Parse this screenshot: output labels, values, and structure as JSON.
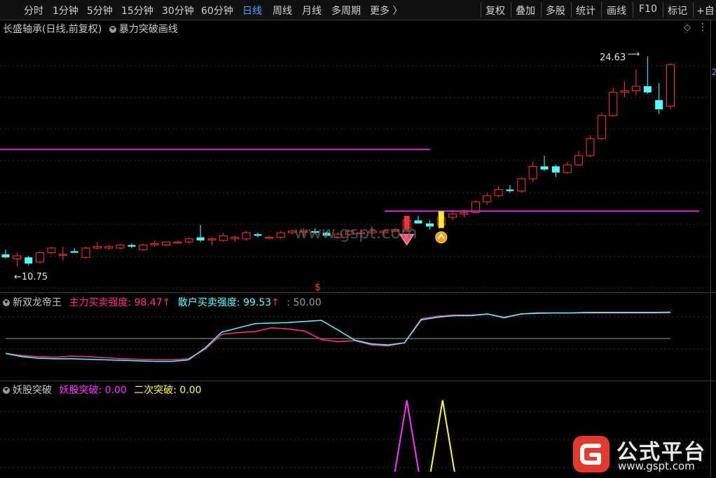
{
  "toolbar": {
    "periods": [
      "分时",
      "1分钟",
      "5分钟",
      "15分钟",
      "30分钟",
      "60分钟",
      "日线",
      "周线",
      "月线",
      "多周期",
      "更多 〉"
    ],
    "active": "日线",
    "right": [
      "复权",
      "叠加",
      "多股",
      "统计",
      "画线",
      "F10",
      "标记",
      "+自"
    ]
  },
  "main": {
    "stock_title": "长盛轴承(日线,前复权)",
    "indicator_title": "暴力突破画线",
    "high_label": "24.63",
    "low_label": "10.75",
    "edge_label": "2",
    "dollar": "$"
  },
  "panel1": {
    "name": "新双龙帝王",
    "main_label": "主力买卖强度:",
    "main_value": "98.47",
    "retail_label": "散户买卖强度:",
    "retail_value": "99.53",
    "level_label": ": 50.00",
    "arrow": "↑"
  },
  "panel2": {
    "name": "妖股突破",
    "yao_label": "妖股突破:",
    "yao_value": "0.00",
    "second_label": "二次突破:",
    "second_value": "0.00"
  },
  "watermark": "www.gspt.com",
  "logo": {
    "text": "公式平台",
    "url": "www.gspt.com"
  },
  "colors": {
    "up": "#ff3333",
    "down": "#54ffff",
    "purple_line": "#cc33cc",
    "yellow": "#ffff33",
    "active_tab": "#4aa3ff"
  },
  "chart_data": {
    "type": "candlestick",
    "price_range": [
      10.75,
      24.63
    ],
    "candles": [
      {
        "o": 11.8,
        "h": 12.1,
        "l": 11.5,
        "c": 11.6
      },
      {
        "o": 11.5,
        "h": 11.9,
        "l": 11.0,
        "c": 11.7
      },
      {
        "o": 11.6,
        "h": 11.7,
        "l": 11.1,
        "c": 11.2
      },
      {
        "o": 11.3,
        "h": 12.0,
        "l": 11.2,
        "c": 11.9
      },
      {
        "o": 11.9,
        "h": 12.3,
        "l": 11.8,
        "c": 12.2
      },
      {
        "o": 11.8,
        "h": 12.3,
        "l": 11.4,
        "c": 11.8
      },
      {
        "o": 12.0,
        "h": 12.2,
        "l": 11.9,
        "c": 11.9
      },
      {
        "o": 11.6,
        "h": 12.3,
        "l": 11.5,
        "c": 12.2
      },
      {
        "o": 12.2,
        "h": 12.6,
        "l": 12.1,
        "c": 12.3
      },
      {
        "o": 12.2,
        "h": 12.4,
        "l": 12.1,
        "c": 12.3
      },
      {
        "o": 12.2,
        "h": 12.5,
        "l": 12.1,
        "c": 12.4
      },
      {
        "o": 12.4,
        "h": 12.5,
        "l": 12.2,
        "c": 12.3
      },
      {
        "o": 12.1,
        "h": 12.5,
        "l": 12.0,
        "c": 12.4
      },
      {
        "o": 12.4,
        "h": 12.7,
        "l": 12.3,
        "c": 12.5
      },
      {
        "o": 12.4,
        "h": 12.6,
        "l": 12.3,
        "c": 12.6
      },
      {
        "o": 12.6,
        "h": 12.7,
        "l": 12.5,
        "c": 12.6
      },
      {
        "o": 12.6,
        "h": 12.9,
        "l": 12.5,
        "c": 12.8
      },
      {
        "o": 12.9,
        "h": 13.7,
        "l": 12.6,
        "c": 12.7
      },
      {
        "o": 12.8,
        "h": 12.9,
        "l": 12.4,
        "c": 12.8
      },
      {
        "o": 12.7,
        "h": 13.2,
        "l": 12.6,
        "c": 13.0
      },
      {
        "o": 12.8,
        "h": 13.0,
        "l": 12.6,
        "c": 12.9
      },
      {
        "o": 12.8,
        "h": 13.3,
        "l": 12.7,
        "c": 13.2
      },
      {
        "o": 13.1,
        "h": 13.2,
        "l": 12.9,
        "c": 13.0
      },
      {
        "o": 12.9,
        "h": 13.0,
        "l": 12.8,
        "c": 12.9
      },
      {
        "o": 12.9,
        "h": 13.3,
        "l": 12.8,
        "c": 13.2
      },
      {
        "o": 13.2,
        "h": 13.4,
        "l": 13.1,
        "c": 13.3
      },
      {
        "o": 13.3,
        "h": 13.5,
        "l": 13.0,
        "c": 13.3
      },
      {
        "o": 13.3,
        "h": 13.5,
        "l": 13.1,
        "c": 13.2
      },
      {
        "o": 13.2,
        "h": 13.3,
        "l": 13.0,
        "c": 13.0
      },
      {
        "o": 12.9,
        "h": 13.2,
        "l": 12.8,
        "c": 13.1
      },
      {
        "o": 13.1,
        "h": 13.4,
        "l": 13.0,
        "c": 13.3
      },
      {
        "o": 13.2,
        "h": 13.4,
        "l": 12.9,
        "c": 13.2
      },
      {
        "o": 13.2,
        "h": 13.5,
        "l": 13.1,
        "c": 13.3
      },
      {
        "o": 13.2,
        "h": 13.4,
        "l": 13.0,
        "c": 13.3
      },
      {
        "o": 13.3,
        "h": 13.5,
        "l": 13.2,
        "c": 13.4
      },
      {
        "o": 13.3,
        "h": 14.1,
        "l": 13.2,
        "c": 14.0
      },
      {
        "o": 14.0,
        "h": 14.3,
        "l": 13.9,
        "c": 13.8
      },
      {
        "o": 13.8,
        "h": 14.0,
        "l": 13.4,
        "c": 13.6
      },
      {
        "o": 13.7,
        "h": 14.4,
        "l": 13.6,
        "c": 14.2
      },
      {
        "o": 14.2,
        "h": 14.6,
        "l": 14.0,
        "c": 14.4
      },
      {
        "o": 14.4,
        "h": 14.7,
        "l": 14.2,
        "c": 14.5
      },
      {
        "o": 14.5,
        "h": 15.3,
        "l": 14.4,
        "c": 15.2
      },
      {
        "o": 15.2,
        "h": 15.8,
        "l": 15.0,
        "c": 15.6
      },
      {
        "o": 15.6,
        "h": 16.2,
        "l": 15.5,
        "c": 16.0
      },
      {
        "o": 16.0,
        "h": 16.3,
        "l": 15.8,
        "c": 15.9
      },
      {
        "o": 15.9,
        "h": 16.8,
        "l": 15.8,
        "c": 16.7
      },
      {
        "o": 16.7,
        "h": 17.8,
        "l": 16.5,
        "c": 17.5
      },
      {
        "o": 17.5,
        "h": 18.2,
        "l": 17.2,
        "c": 17.3
      },
      {
        "o": 17.5,
        "h": 17.6,
        "l": 16.8,
        "c": 17.1
      },
      {
        "o": 17.1,
        "h": 17.8,
        "l": 17.0,
        "c": 17.6
      },
      {
        "o": 17.6,
        "h": 18.5,
        "l": 17.5,
        "c": 18.2
      },
      {
        "o": 18.2,
        "h": 19.5,
        "l": 18.1,
        "c": 19.3
      },
      {
        "o": 19.3,
        "h": 21.0,
        "l": 19.2,
        "c": 20.8
      },
      {
        "o": 20.8,
        "h": 22.6,
        "l": 20.7,
        "c": 22.3
      },
      {
        "o": 22.3,
        "h": 23.0,
        "l": 22.0,
        "c": 22.4
      },
      {
        "o": 22.4,
        "h": 23.8,
        "l": 22.1,
        "c": 22.7
      },
      {
        "o": 22.7,
        "h": 24.63,
        "l": 22.2,
        "c": 22.3
      },
      {
        "o": 21.8,
        "h": 22.9,
        "l": 20.9,
        "c": 21.2
      },
      {
        "o": 21.4,
        "h": 24.2,
        "l": 21.2,
        "c": 24.1
      }
    ],
    "resistance_lines": [
      18.6,
      14.6
    ],
    "signals": [
      "diamond",
      "arrow-up"
    ],
    "indicator1": {
      "series": [
        {
          "name": "主力买卖强度",
          "values": [
            22,
            18,
            16,
            15,
            17,
            16,
            14,
            12,
            11,
            10,
            10,
            12,
            30,
            58,
            61,
            63,
            70,
            68,
            64,
            48,
            44,
            46,
            38,
            36,
            42,
            87,
            92,
            94,
            94,
            96,
            90,
            96,
            97,
            98,
            98,
            98,
            98,
            98,
            98,
            98,
            98.47
          ]
        },
        {
          "name": "散户买卖强度",
          "values": [
            22,
            16,
            13,
            12,
            12,
            11,
            10,
            9,
            8,
            7,
            7,
            10,
            32,
            62,
            70,
            78,
            79,
            80,
            82,
            84,
            66,
            47,
            40,
            38,
            42,
            85,
            90,
            93,
            93,
            96,
            89,
            96,
            98,
            98,
            98,
            99,
            99,
            99,
            99,
            99,
            99.53
          ]
        }
      ],
      "level": 50
    },
    "indicator2": {
      "series": [
        {
          "name": "妖股突破",
          "spike_at": "signal1"
        },
        {
          "name": "二次突破",
          "spike_at": "signal2"
        }
      ]
    }
  }
}
